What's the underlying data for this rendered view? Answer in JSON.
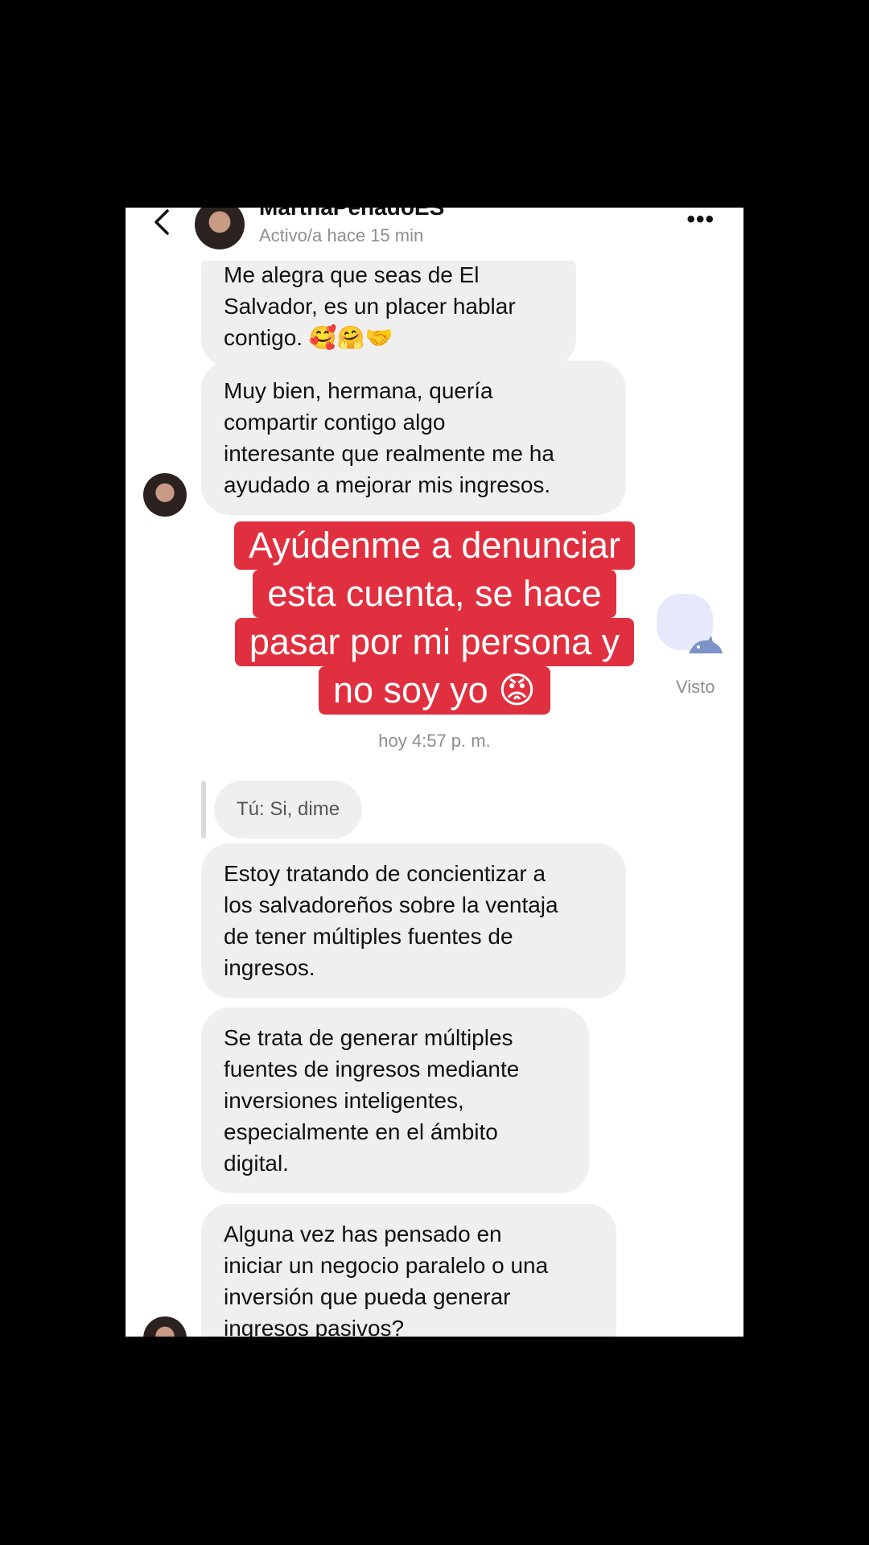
{
  "header": {
    "name": "MarthaPeñadoES",
    "status": "Activo/a hace 15 min",
    "more_label": "•••"
  },
  "messages": [
    {
      "text": "Me alegra que seas de El\nSalvador, es un placer hablar\ncontigo. 🥰🤗🤝"
    },
    {
      "text": "Muy bien, hermana, quería\ncompartir contigo algo\ninteresante que realmente me ha\nayudado a mejorar mis ingresos."
    },
    {
      "text": "Estoy tratando de concientizar a\nlos salvadoreños sobre la ventaja\nde tener múltiples fuentes de\ningresos."
    },
    {
      "text": "Se trata de generar múltiples\nfuentes de ingresos mediante\ninversiones inteligentes,\nespecialmente en el ámbito\ndigital."
    },
    {
      "text": "Alguna vez has pensado en\niniciar un negocio paralelo o una\ninversión que pueda generar\ningresos pasivos?"
    }
  ],
  "timestamp": "hoy 4:57 p. m.",
  "reply": "Tú: Si, dime",
  "seen": "Visto",
  "overlay_lines": [
    "Ayúdenme a denunciar",
    "esta cuenta, se hace",
    "pasar por mi persona y",
    "no soy yo 😡"
  ]
}
